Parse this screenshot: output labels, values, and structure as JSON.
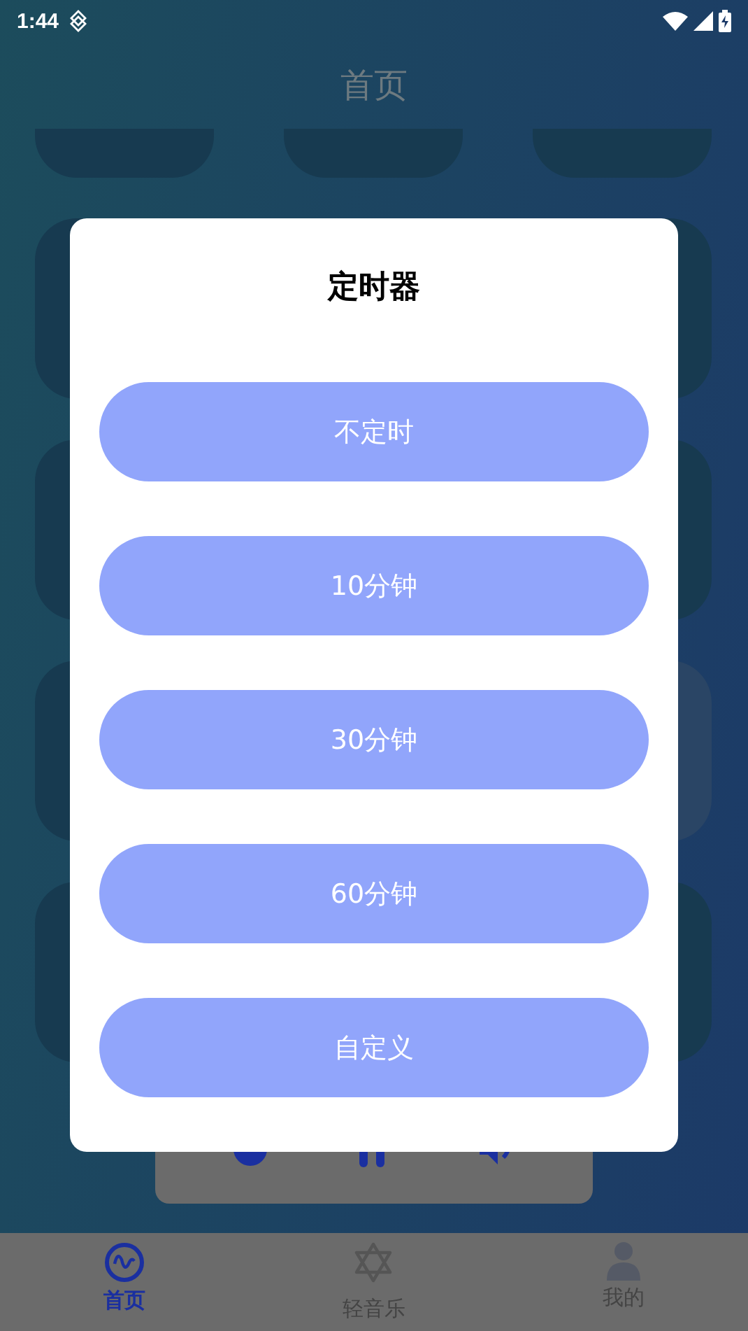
{
  "status_bar": {
    "time": "1:44"
  },
  "header": {
    "title": "首页"
  },
  "card_rows": [
    [
      {
        "selected": false
      },
      {
        "selected": false
      },
      {
        "selected": false
      }
    ],
    [
      {
        "selected": false
      },
      {
        "selected": false
      }
    ],
    [
      {
        "selected": false
      },
      {
        "selected": false
      }
    ],
    [
      {
        "selected": false
      },
      {
        "selected": true
      }
    ],
    [
      {
        "selected": false
      },
      {
        "selected": false
      }
    ]
  ],
  "timer_dialog": {
    "title": "定时器",
    "options": [
      "不定时",
      "10分钟",
      "30分钟",
      "60分钟",
      "自定义"
    ]
  },
  "bottom_nav": [
    {
      "label": "首页",
      "kind": "wave",
      "selected": true
    },
    {
      "label": "轻音乐",
      "kind": "star",
      "selected": false
    },
    {
      "label": "我的",
      "kind": "person",
      "selected": false
    }
  ]
}
